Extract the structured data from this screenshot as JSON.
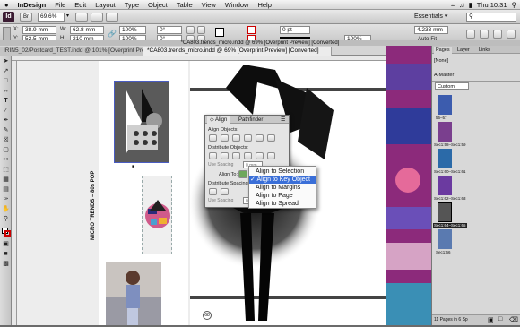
{
  "menubar": {
    "apple": "",
    "app_name": "InDesign",
    "items": [
      "File",
      "Edit",
      "Layout",
      "Type",
      "Object",
      "Table",
      "View",
      "Window",
      "Help"
    ],
    "clock": "Thu 10:31"
  },
  "appbar": {
    "logo": "Id",
    "zoom": "69.6%",
    "workspace": "Essentials"
  },
  "control": {
    "x_label": "X:",
    "x_value": "38.9 mm",
    "y_label": "Y:",
    "y_value": "52.5 mm",
    "w_label": "W:",
    "w_value": "62.8 mm",
    "h_label": "H:",
    "h_value": "210 mm",
    "scale_x": "100%",
    "scale_y": "100%",
    "rotate": "0°",
    "shear": "0°",
    "stroke_weight": "0 pt",
    "opacity": "100%",
    "width_right": "4.233 mm",
    "auto_fit": "Auto-Fit"
  },
  "document": {
    "window_title": "*CA803.trends_micro.indd @ 69% [Overprint Preview] [Converted]",
    "tabs": [
      "IRIN5_02/Postcard_TEST.indd @ 101% [Overprint Preview]",
      "*CA803.trends_micro.indd @ 69% [Overprint Preview] [Converted]"
    ],
    "vertical_label": "MICRO TRENDS – 80s POP",
    "page_number": "68"
  },
  "align_panel": {
    "tab_align": "◇ Align",
    "tab_pathfinder": "Pathfinder",
    "align_objects": "Align Objects:",
    "distribute_objects": "Distribute Objects:",
    "use_spacing": "Use Spacing",
    "spacing_value": "0 mm",
    "align_to": "Align To:",
    "distribute_spacing": "Distribute Spacing:",
    "use_spacing_2": "Use Spacing",
    "spacing_value_2": "0 mm"
  },
  "align_menu": {
    "items": [
      {
        "label": "Align to Selection",
        "checked": false
      },
      {
        "label": "Align to Key Object",
        "checked": true
      },
      {
        "label": "Align to Margins",
        "checked": false
      },
      {
        "label": "Align to Page",
        "checked": false
      },
      {
        "label": "Align to Spread",
        "checked": false
      }
    ]
  },
  "pages_panel": {
    "tab_pages": "Pages",
    "tab_layers": "Layer",
    "tab_links": "Links",
    "none": "[None]",
    "master": "A-Master",
    "size": "Custom",
    "spreads": [
      "56–57",
      "Sec1:58–Sec1:59",
      "Sec1:60–Sec1:61",
      "Sec1:62–Sec1:63",
      "Sec1:64–Sec1:65",
      "Sec1:66"
    ],
    "footer": "11 Pages in 6 Sp"
  },
  "colors": {
    "accent": "#3a6fd8",
    "indesign_logo": "#3b1c33",
    "magenta_strip": "#8c2a7b"
  }
}
